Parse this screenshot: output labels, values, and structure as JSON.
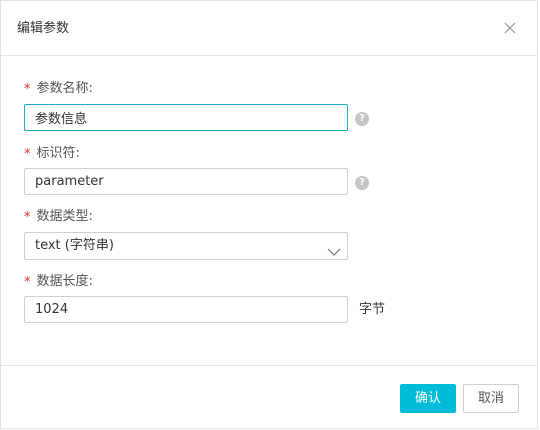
{
  "dialog": {
    "title": "编辑参数",
    "close_icon": "close-icon"
  },
  "fields": {
    "param_name": {
      "label": "参数名称:",
      "value": "参数信息",
      "required": true,
      "help_icon": "question-icon"
    },
    "identifier": {
      "label": "标识符:",
      "value": "parameter",
      "required": true,
      "help_icon": "question-icon"
    },
    "data_type": {
      "label": "数据类型:",
      "selected": "text (字符串)",
      "required": true,
      "dropdown_icon": "chevron-down-icon"
    },
    "data_length": {
      "label": "数据长度:",
      "value": "1024",
      "unit": "字节",
      "required": true
    }
  },
  "required_mark": "*",
  "help_glyph": "?",
  "footer": {
    "confirm_label": "确认",
    "cancel_label": "取消"
  },
  "colors": {
    "accent": "#00bcd9",
    "focus_border": "#21a9cf",
    "required": "#e0362c"
  }
}
